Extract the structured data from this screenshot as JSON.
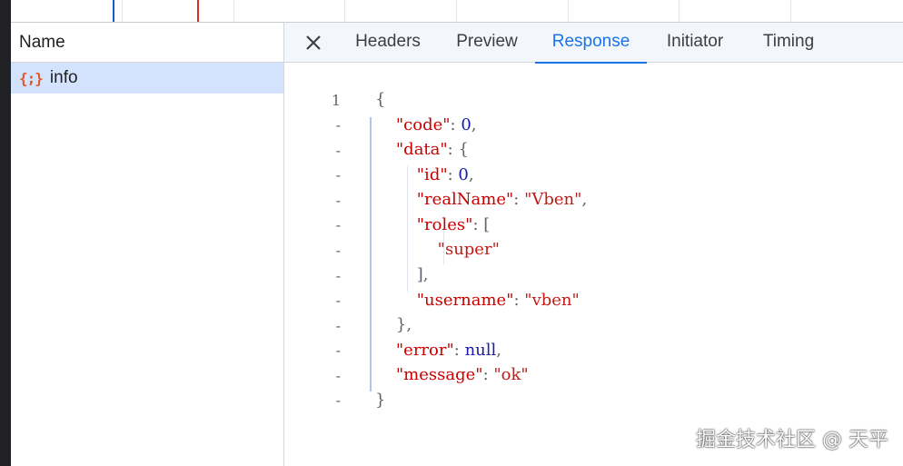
{
  "name_column": {
    "header": "Name",
    "requests": [
      {
        "icon": "{;}",
        "name": "info"
      }
    ]
  },
  "tabs": [
    "Headers",
    "Preview",
    "Response",
    "Initiator",
    "Timing"
  ],
  "active_tab": "Response",
  "response": {
    "gutter": [
      "1",
      "-",
      "-",
      "-",
      "-",
      "-",
      "-",
      "-",
      "-",
      "-",
      "-",
      "-",
      "-"
    ],
    "code": "0",
    "id": "0",
    "realName": "Vben",
    "role": "super",
    "username": "vben",
    "error": "null",
    "message": "ok"
  },
  "watermark": "掘金技术社区 @ 天平",
  "colors": {
    "accent": "#1a73e8",
    "selected_row": "#d3e3fd",
    "json_key": "#c80000",
    "json_string": "#c41a16",
    "json_number": "#1a1aa6"
  }
}
